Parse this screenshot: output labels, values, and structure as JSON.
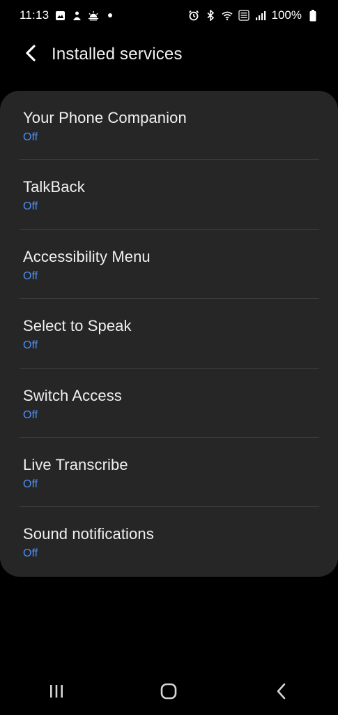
{
  "status_bar": {
    "time": "11:13",
    "left_icons": [
      "gallery-icon",
      "bixby-icon",
      "weather-icon",
      "dot-icon"
    ],
    "right_icons": [
      "alarm-icon",
      "bluetooth-icon",
      "wifi-icon",
      "volte-icon",
      "signal-icon"
    ],
    "battery_text": "100%"
  },
  "header": {
    "title": "Installed services",
    "back_icon": "chevron-left-icon"
  },
  "services": [
    {
      "name": "Your Phone Companion",
      "status": "Off"
    },
    {
      "name": "TalkBack",
      "status": "Off"
    },
    {
      "name": "Accessibility Menu",
      "status": "Off"
    },
    {
      "name": "Select to Speak",
      "status": "Off"
    },
    {
      "name": "Switch Access",
      "status": "Off"
    },
    {
      "name": "Live Transcribe",
      "status": "Off"
    },
    {
      "name": "Sound notifications",
      "status": "Off"
    }
  ],
  "nav_bar": {
    "items": [
      "recents-icon",
      "home-icon",
      "back-icon"
    ]
  },
  "colors": {
    "background": "#000000",
    "card": "#262626",
    "status_blue": "#4d8ff0",
    "text": "#f0f0f0"
  }
}
